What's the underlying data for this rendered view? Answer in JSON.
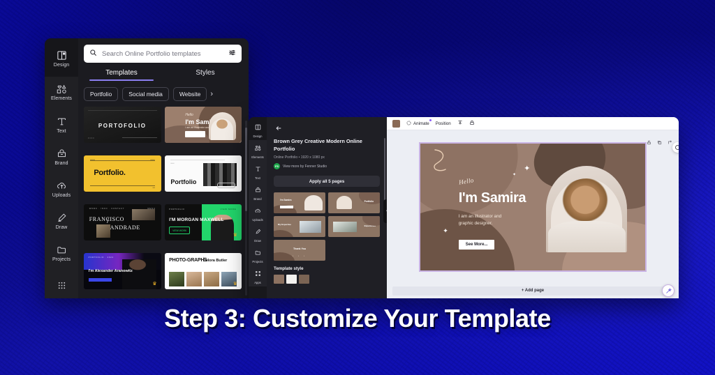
{
  "heading": "Step 3: Customize Your Template",
  "theme": {
    "background_blue": "#0a0a9c",
    "accent_purple": "#8b7ff0",
    "avatar_green": "#1ea84b"
  },
  "picker_window": {
    "sidebar": [
      {
        "label": "Design",
        "icon": "design-icon"
      },
      {
        "label": "Elements",
        "icon": "elements-icon"
      },
      {
        "label": "Text",
        "icon": "text-icon"
      },
      {
        "label": "Brand",
        "icon": "brand-icon"
      },
      {
        "label": "Uploads",
        "icon": "uploads-icon"
      },
      {
        "label": "Draw",
        "icon": "draw-icon"
      },
      {
        "label": "Projects",
        "icon": "projects-icon"
      },
      {
        "label": "",
        "icon": "apps-grid-icon"
      }
    ],
    "search": {
      "placeholder": "Search Online Portfolio templates",
      "icon": "search-icon",
      "filter_icon": "sliders-icon"
    },
    "tabs": [
      {
        "label": "Templates",
        "active": true
      },
      {
        "label": "Styles",
        "active": false
      }
    ],
    "chips": [
      "Portfolio",
      "Social media",
      "Website"
    ],
    "chips_next_icon": "chevron-right-icon",
    "templates": [
      {
        "name": "PORTOFOLIO"
      },
      {
        "name": "I'm Samira",
        "hello": "Hello",
        "sub": "I am an illustrator and graphic designer.",
        "button": "See More..."
      },
      {
        "name": "Portfolio."
      },
      {
        "name": "Portfolio"
      },
      {
        "name": "FRANCISCO",
        "name2": "ANDRADE"
      },
      {
        "name": "I'M MORGAN MAXWELL",
        "button": "VIEW WORK"
      },
      {
        "name": "I'm Alexander Aranowitz"
      },
      {
        "name": "PHOTO-GRAPHS",
        "by": "by",
        "author": "Delora Butler"
      }
    ]
  },
  "editor_window": {
    "sidebar": [
      {
        "label": "Design",
        "icon": "design-icon"
      },
      {
        "label": "Elements",
        "icon": "elements-icon"
      },
      {
        "label": "Text",
        "icon": "text-icon"
      },
      {
        "label": "Brand",
        "icon": "brand-icon"
      },
      {
        "label": "Uploads",
        "icon": "uploads-icon"
      },
      {
        "label": "Draw",
        "icon": "draw-icon"
      },
      {
        "label": "Projects",
        "icon": "projects-icon"
      },
      {
        "label": "Apps",
        "icon": "apps-grid-icon"
      }
    ],
    "back_icon": "arrow-left-icon",
    "detail": {
      "title": "Brown Grey Creative Modern Online Portfolio",
      "meta": "Online Portfolio • 1920 x 1080 px",
      "avatar_initials": "FS",
      "author_link": "View more by Fenner Studio",
      "apply_button": "Apply all 5 pages",
      "style_label": "Template style",
      "page_count": 5,
      "page_labels": [
        "I'm Samira",
        "Portfolio",
        "My Expertise",
        "Experience",
        "Thank You"
      ]
    },
    "toolbar": {
      "color_swatch": "#8a6a55",
      "animate": "Animate",
      "position": "Position",
      "transparency_icon": "transparency-icon",
      "lock_icon": "lock-icon",
      "animate_badge": true
    },
    "canvas_tools": [
      "lock-icon",
      "duplicate-icon",
      "expand-icon"
    ],
    "refresh_icon": "refresh-icon",
    "canvas": {
      "hello": "Hello",
      "name": "I'm Samira",
      "subtitle": "I am an illustrator and\ngraphic designer.",
      "button": "See More..."
    },
    "add_page": "+ Add page",
    "magic_icon": "magic-wand-icon"
  }
}
